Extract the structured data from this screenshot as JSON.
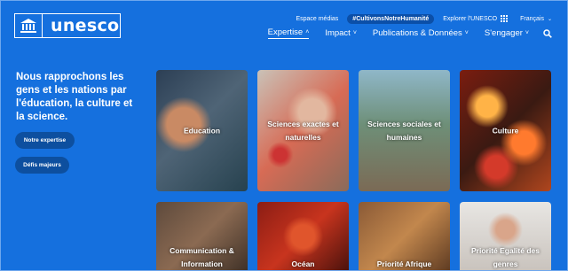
{
  "header": {
    "logo_text": "unesco",
    "utility": {
      "media": "Espace médias",
      "hashtag": "#CultivonsNotreHumanité",
      "explore": "Explorer l'UNESCO",
      "language": "Français"
    },
    "nav": [
      {
        "label": "Expertise"
      },
      {
        "label": "Impact"
      },
      {
        "label": "Publications & Données"
      },
      {
        "label": "S'engager"
      }
    ]
  },
  "hero": {
    "title": "Nous rapprochons les gens et les nations par l'éducation, la culture et la science.",
    "button_expertise": "Notre expertise",
    "button_challenges": "Défis majeurs"
  },
  "cards": [
    {
      "label": "Education"
    },
    {
      "label": "Sciences exactes et naturelles"
    },
    {
      "label": "Sciences sociales et humaines"
    },
    {
      "label": "Culture"
    },
    {
      "label": "Communication & Information"
    },
    {
      "label": "Océan"
    },
    {
      "label": "Priorité Afrique"
    },
    {
      "label": "Priorité Egalité des genres"
    }
  ],
  "colors": {
    "background": "#1570de",
    "button": "#0d4f9f"
  }
}
